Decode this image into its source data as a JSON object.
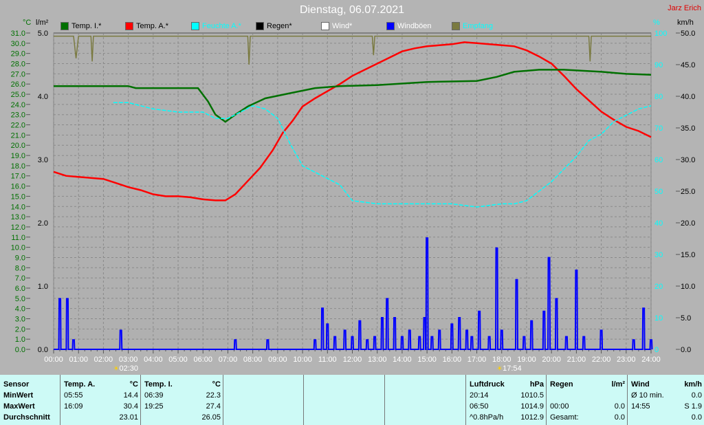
{
  "header": {
    "title": "Dienstag, 06.07.2021",
    "author": "Jarz Erich"
  },
  "axis_units": {
    "temp": "°C",
    "rain": "l/m²",
    "humidity": "%",
    "wind": "km/h"
  },
  "legend": [
    {
      "label": "Temp. I.*",
      "color": "#007000",
      "text_color": "#000000"
    },
    {
      "label": "Temp. A.*",
      "color": "#ff0000",
      "text_color": "#000000"
    },
    {
      "label": "Feuchte A.*",
      "color": "#00ffff",
      "text_color": "#00ffff"
    },
    {
      "label": "Regen*",
      "color": "#000000",
      "text_color": "#000000"
    },
    {
      "label": "Wind*",
      "color": "#ffffff",
      "text_color": "#ffffff"
    },
    {
      "label": "Windböen",
      "color": "#0000ff",
      "text_color": "#ffffff"
    },
    {
      "label": "Empfang",
      "color": "#7a7a40",
      "text_color": "#00ffff"
    }
  ],
  "chart_data": {
    "type": "line",
    "title": "Dienstag, 06.07.2021",
    "x_ticks": [
      "00:00",
      "01:00",
      "02:00",
      "03:00",
      "04:00",
      "05:00",
      "06:00",
      "07:00",
      "08:00",
      "09:00",
      "10:00",
      "11:00",
      "12:00",
      "13:00",
      "14:00",
      "15:00",
      "16:00",
      "17:00",
      "18:00",
      "19:00",
      "20:00",
      "21:00",
      "22:00",
      "23:00",
      "24:00"
    ],
    "xlim": [
      0,
      24
    ],
    "temp_axis": {
      "min": 0,
      "max": 31,
      "step": 1
    },
    "rain_axis": {
      "min": 0,
      "max": 5,
      "ticks": [
        "0.0",
        "1.0",
        "2.0",
        "3.0",
        "4.0",
        "5.0"
      ]
    },
    "humidity_axis": {
      "min": 0,
      "max": 100,
      "ticks": [
        "0",
        "10",
        "20",
        "30",
        "40",
        "50",
        "60",
        "70",
        "80",
        "90",
        "100"
      ]
    },
    "wind_axis": {
      "min": 0,
      "max": 50,
      "ticks": [
        "0.0",
        "5.0",
        "10.0",
        "15.0",
        "20.0",
        "25.0",
        "30.0",
        "35.0",
        "40.0",
        "45.0",
        "50.0"
      ]
    },
    "markers": [
      {
        "label": "02:30",
        "x": 2.5
      },
      {
        "label": "17:54",
        "x": 17.9
      }
    ],
    "series": [
      {
        "name": "Temp. A.*",
        "axis": "temp",
        "color": "#ff0000",
        "points": [
          [
            0,
            17.4
          ],
          [
            0.5,
            17.0
          ],
          [
            1,
            16.9
          ],
          [
            1.5,
            16.8
          ],
          [
            2,
            16.7
          ],
          [
            2.5,
            16.3
          ],
          [
            3,
            15.9
          ],
          [
            3.5,
            15.6
          ],
          [
            4,
            15.2
          ],
          [
            4.5,
            15.0
          ],
          [
            5,
            15.0
          ],
          [
            5.5,
            14.9
          ],
          [
            6,
            14.7
          ],
          [
            6.5,
            14.6
          ],
          [
            6.9,
            14.6
          ],
          [
            7.3,
            15.2
          ],
          [
            7.8,
            16.5
          ],
          [
            8.3,
            17.8
          ],
          [
            8.8,
            19.5
          ],
          [
            9.2,
            21.2
          ],
          [
            9.6,
            22.4
          ],
          [
            10,
            23.8
          ],
          [
            10.5,
            24.6
          ],
          [
            11,
            25.3
          ],
          [
            11.5,
            26.0
          ],
          [
            12,
            26.8
          ],
          [
            12.5,
            27.4
          ],
          [
            13,
            28.0
          ],
          [
            13.5,
            28.6
          ],
          [
            14,
            29.2
          ],
          [
            14.5,
            29.5
          ],
          [
            15,
            29.7
          ],
          [
            15.5,
            29.8
          ],
          [
            16,
            29.9
          ],
          [
            16.5,
            30.1
          ],
          [
            17,
            30.0
          ],
          [
            17.5,
            29.9
          ],
          [
            18,
            29.8
          ],
          [
            18.5,
            29.7
          ],
          [
            19,
            29.3
          ],
          [
            19.5,
            28.7
          ],
          [
            20,
            28.0
          ],
          [
            20.5,
            26.8
          ],
          [
            21,
            25.5
          ],
          [
            21.5,
            24.4
          ],
          [
            22,
            23.3
          ],
          [
            22.5,
            22.5
          ],
          [
            23,
            21.8
          ],
          [
            23.5,
            21.4
          ],
          [
            24,
            20.8
          ]
        ]
      },
      {
        "name": "Temp. I.*",
        "axis": "temp",
        "color": "#007000",
        "points": [
          [
            0,
            25.8
          ],
          [
            3,
            25.8
          ],
          [
            3.3,
            25.6
          ],
          [
            5.8,
            25.6
          ],
          [
            6.2,
            24.3
          ],
          [
            6.5,
            23.0
          ],
          [
            6.9,
            22.3
          ],
          [
            7.3,
            23.0
          ],
          [
            7.8,
            23.8
          ],
          [
            8.5,
            24.6
          ],
          [
            9.5,
            25.1
          ],
          [
            10.5,
            25.6
          ],
          [
            11.5,
            25.8
          ],
          [
            13,
            25.9
          ],
          [
            15,
            26.2
          ],
          [
            17,
            26.3
          ],
          [
            17.8,
            26.7
          ],
          [
            18.5,
            27.2
          ],
          [
            19.5,
            27.4
          ],
          [
            20.5,
            27.4
          ],
          [
            22,
            27.2
          ],
          [
            23,
            27.0
          ],
          [
            24,
            26.9
          ]
        ]
      },
      {
        "name": "Feuchte A.*",
        "axis": "humidity",
        "color": "#00ffff",
        "points": [
          [
            2.4,
            78
          ],
          [
            3,
            78
          ],
          [
            3.5,
            77
          ],
          [
            4,
            76
          ],
          [
            5,
            75
          ],
          [
            6,
            75
          ],
          [
            6.5,
            73
          ],
          [
            7,
            73
          ],
          [
            7.5,
            75
          ],
          [
            8,
            77
          ],
          [
            8.5,
            76
          ],
          [
            9,
            73
          ],
          [
            9.5,
            65
          ],
          [
            10,
            58
          ],
          [
            10.5,
            56
          ],
          [
            11,
            54
          ],
          [
            11.5,
            52
          ],
          [
            12,
            47
          ],
          [
            13,
            46
          ],
          [
            14,
            46
          ],
          [
            15,
            46
          ],
          [
            16,
            46
          ],
          [
            17,
            45
          ],
          [
            18,
            46
          ],
          [
            18.5,
            46
          ],
          [
            19,
            47
          ],
          [
            19.5,
            50
          ],
          [
            20,
            53
          ],
          [
            20.5,
            57
          ],
          [
            21,
            61
          ],
          [
            21.5,
            66
          ],
          [
            22,
            68
          ],
          [
            22.5,
            72
          ],
          [
            23,
            74
          ],
          [
            23.5,
            76
          ],
          [
            24,
            77
          ]
        ]
      },
      {
        "name": "Empfang",
        "axis": "humidity",
        "color": "#7a7a40",
        "points": [
          [
            0,
            99
          ],
          [
            0.8,
            99
          ],
          [
            0.9,
            92
          ],
          [
            1,
            99
          ],
          [
            1.5,
            99
          ],
          [
            1.55,
            91
          ],
          [
            1.6,
            99
          ],
          [
            7.8,
            99
          ],
          [
            7.85,
            90
          ],
          [
            7.9,
            99
          ],
          [
            12.8,
            99
          ],
          [
            12.85,
            93
          ],
          [
            12.9,
            99
          ],
          [
            21.5,
            99
          ],
          [
            21.55,
            91
          ],
          [
            21.6,
            99
          ],
          [
            24,
            99
          ]
        ]
      },
      {
        "name": "Windböen",
        "axis": "wind",
        "color": "#0000ff",
        "type": "spikes",
        "points": [
          [
            0.25,
            8
          ],
          [
            0.55,
            8
          ],
          [
            0.8,
            1.5
          ],
          [
            2.7,
            3
          ],
          [
            7.3,
            1.5
          ],
          [
            8.6,
            1.5
          ],
          [
            10.5,
            1.5
          ],
          [
            10.8,
            6.5
          ],
          [
            11.0,
            4
          ],
          [
            11.3,
            2
          ],
          [
            11.7,
            3
          ],
          [
            12.0,
            2
          ],
          [
            12.3,
            4.5
          ],
          [
            12.6,
            1.5
          ],
          [
            12.9,
            2
          ],
          [
            13.2,
            5
          ],
          [
            13.4,
            8
          ],
          [
            13.7,
            5
          ],
          [
            14.0,
            2
          ],
          [
            14.3,
            3
          ],
          [
            14.7,
            2
          ],
          [
            14.9,
            5
          ],
          [
            15.0,
            17.6
          ],
          [
            15.2,
            2
          ],
          [
            15.5,
            3
          ],
          [
            16.0,
            4
          ],
          [
            16.3,
            5
          ],
          [
            16.6,
            3
          ],
          [
            16.8,
            2
          ],
          [
            17.1,
            6
          ],
          [
            17.5,
            2
          ],
          [
            17.8,
            16
          ],
          [
            18.0,
            3
          ],
          [
            18.6,
            11
          ],
          [
            18.9,
            2
          ],
          [
            19.2,
            4.5
          ],
          [
            19.7,
            6
          ],
          [
            19.9,
            14.5
          ],
          [
            20.2,
            8
          ],
          [
            20.6,
            2
          ],
          [
            21.0,
            12.5
          ],
          [
            21.3,
            2
          ],
          [
            22.0,
            3
          ],
          [
            23.3,
            1.5
          ],
          [
            23.7,
            6.5
          ],
          [
            24,
            1.5
          ]
        ]
      }
    ]
  },
  "table": {
    "sensor": {
      "header": "Sensor",
      "rows": [
        "MinWert",
        "MaxWert",
        "Durchschnitt"
      ]
    },
    "temp_a": {
      "header": "Temp. A.",
      "unit": "°C",
      "min_time": "05:55",
      "min": "14.4",
      "max_time": "16:09",
      "max": "30.4",
      "avg": "23.01"
    },
    "temp_i": {
      "header": "Temp. I.",
      "unit": "°C",
      "min_time": "06:39",
      "min": "22.3",
      "max_time": "19:25",
      "max": "27.4",
      "avg": "26.05"
    },
    "pressure": {
      "header": "Luftdruck",
      "unit": "hPa",
      "min_time": "20:14",
      "min": "1010.5",
      "max_time": "06:50",
      "max": "1014.9",
      "trend": "^0.8hPa/h",
      "avg": "1012.9"
    },
    "rain": {
      "header": "Regen",
      "unit": "l/m²",
      "max_time": "00:00",
      "max": "0.0",
      "total_label": "Gesamt:",
      "total": "0.0"
    },
    "wind": {
      "header": "Wind",
      "unit": "km/h",
      "avg_label": "Ø 10 min.",
      "avg": "0.0",
      "max_time": "14:55",
      "max": "S 1.9",
      "last": "0.0"
    }
  }
}
